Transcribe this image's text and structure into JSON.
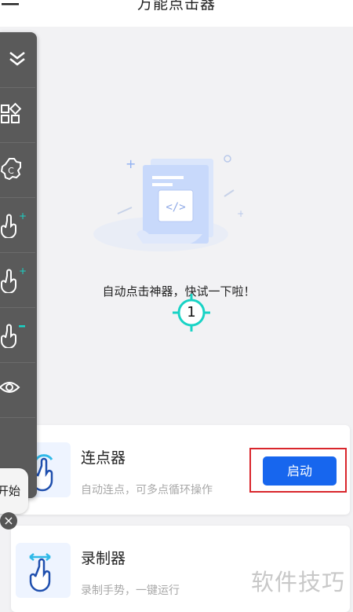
{
  "header": {
    "title": "万能点击器"
  },
  "empty_state": {
    "tagline": "自动点击神器，快试一下啦！"
  },
  "target_marker": {
    "number": "1"
  },
  "float_toolbar": {
    "items": [
      {
        "icon": "collapse-icon"
      },
      {
        "icon": "grid-icon"
      },
      {
        "icon": "settings-icon"
      },
      {
        "icon": "add-tap-point-icon"
      },
      {
        "icon": "add-swipe-point-icon"
      },
      {
        "icon": "remove-point-icon"
      },
      {
        "icon": "eye-icon"
      }
    ],
    "start_label": "开始",
    "close_symbol": "×"
  },
  "cards": [
    {
      "title": "连点器",
      "desc": "自动连点，可多点循环操作",
      "action_label": "启动"
    },
    {
      "title": "录制器",
      "desc": "录制手势，一键运行"
    }
  ],
  "watermark": "软件技巧",
  "colors": {
    "primary": "#1766ee",
    "highlight": "#d9262c",
    "accent": "#19d3c5"
  }
}
